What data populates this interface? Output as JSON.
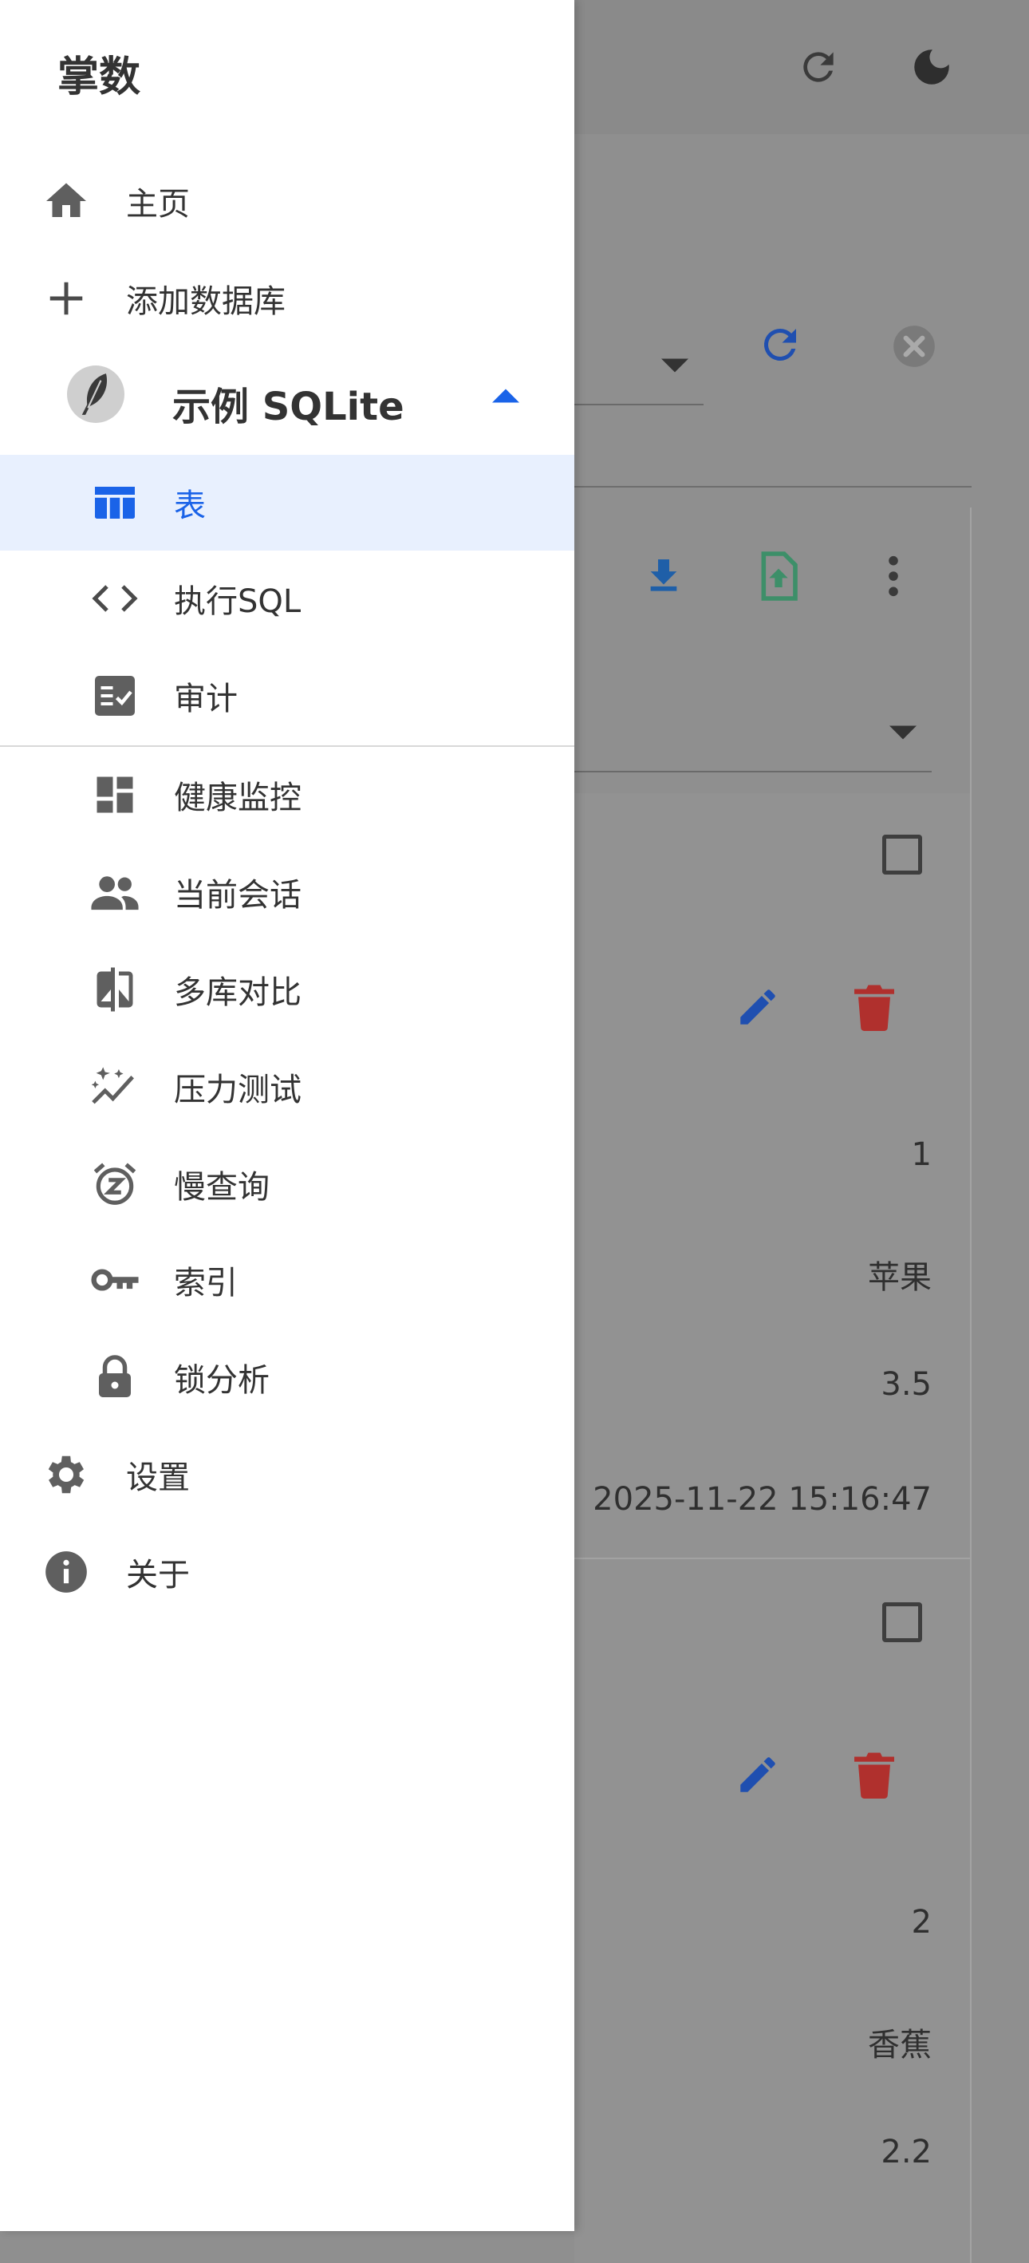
{
  "drawer": {
    "title": "掌数",
    "items_top": [
      {
        "label": "主页",
        "icon": "home-icon"
      },
      {
        "label": "添加数据库",
        "icon": "plus-icon"
      }
    ],
    "database": {
      "name": "示例 SQLite",
      "icon": "feather-icon",
      "expanded": true
    },
    "db_items": [
      {
        "label": "表",
        "icon": "table-icon",
        "active": true
      },
      {
        "label": "执行SQL",
        "icon": "code-icon"
      },
      {
        "label": "审计",
        "icon": "checklist-icon"
      }
    ],
    "tool_items": [
      {
        "label": "健康监控",
        "icon": "dashboard-icon"
      },
      {
        "label": "当前会话",
        "icon": "people-icon"
      },
      {
        "label": "多库对比",
        "icon": "compare-icon"
      },
      {
        "label": "压力测试",
        "icon": "sparkline-icon"
      },
      {
        "label": "慢查询",
        "icon": "snooze-alarm-icon"
      },
      {
        "label": "索引",
        "icon": "key-icon"
      },
      {
        "label": "锁分析",
        "icon": "lock-icon"
      }
    ],
    "bottom_items": [
      {
        "label": "设置",
        "icon": "gear-icon"
      },
      {
        "label": "关于",
        "icon": "info-icon"
      }
    ]
  },
  "background": {
    "records": [
      {
        "id": "1",
        "name": "苹果",
        "price": "3.5",
        "time": "2025-11-22 15:16:47"
      },
      {
        "id": "2",
        "name": "香蕉",
        "price": "2.2"
      }
    ]
  },
  "colors": {
    "accent": "#1a63e8",
    "active_bg": "#e8f0fe",
    "icon_gray": "#5f5f5f",
    "download_blue": "#1f5fa8",
    "upload_green": "#3d8f69",
    "delete_red": "#b0302d",
    "edit_blue": "#1f4fb0"
  }
}
